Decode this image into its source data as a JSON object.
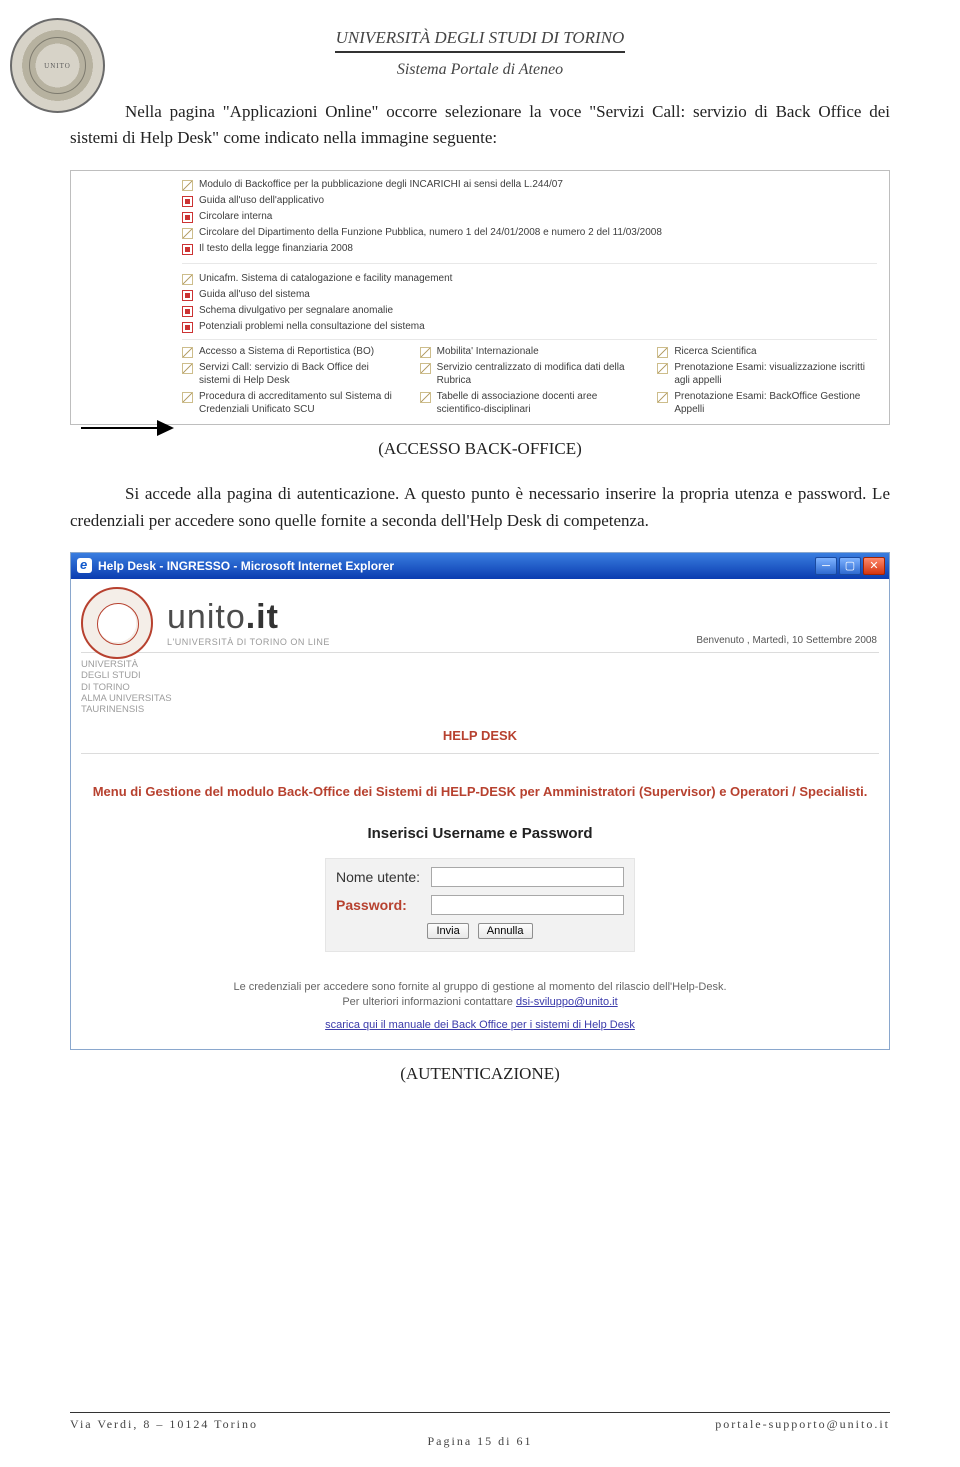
{
  "header": {
    "title": "UNIVERSITÀ DEGLI STUDI DI TORINO",
    "subtitle": "Sistema Portale di Ateneo"
  },
  "body": {
    "p1": "Nella pagina \"Applicazioni Online\" occorre selezionare la voce \"Servizi Call: servizio di Back Office dei sistemi di Help Desk\" come indicato nella immagine seguente:",
    "caption1": "(ACCESSO BACK-OFFICE)",
    "p2": "Si accede alla pagina di autenticazione. A questo punto è necessario inserire la propria utenza e password. Le credenziali per accedere sono quelle fornite a seconda dell'Help Desk di competenza.",
    "caption2": "(AUTENTICAZIONE)"
  },
  "shot1": {
    "rows": [
      {
        "icon": "link",
        "text": "Modulo di Backoffice per la pubblicazione degli INCARICHI ai sensi della L.244/07"
      },
      {
        "icon": "pdf",
        "text": "Guida all'uso dell'applicativo"
      },
      {
        "icon": "pdf",
        "text": "Circolare interna"
      },
      {
        "icon": "link",
        "text": "Circolare del Dipartimento della Funzione Pubblica, numero 1 del 24/01/2008 e numero 2 del 11/03/2008"
      },
      {
        "icon": "pdf",
        "text": "Il testo della legge finanziaria 2008"
      }
    ],
    "rows2": [
      {
        "icon": "link",
        "text": "Unicafm. Sistema di catalogazione e facility management"
      },
      {
        "icon": "pdf",
        "text": "Guida all'uso del sistema"
      },
      {
        "icon": "pdf",
        "text": "Schema divulgativo per segnalare anomalie"
      },
      {
        "icon": "pdf",
        "text": "Potenziali problemi nella consultazione del sistema"
      }
    ],
    "grid": [
      [
        "Accesso a Sistema di Reportistica (BO)",
        "Mobilita' Internazionale",
        "Ricerca Scientifica"
      ],
      [
        "Servizi Call: servizio di Back Office dei sistemi di Help Desk",
        "Servizio centralizzato di modifica dati della Rubrica",
        "Prenotazione Esami: visualizzazione iscritti agli appelli"
      ],
      [
        "Procedura di accreditamento sul Sistema di Credenziali Unificato SCU",
        "Tabelle di associazione docenti aree scientifico-disciplinari",
        "Prenotazione Esami: BackOffice Gestione Appelli"
      ]
    ]
  },
  "shot2": {
    "window_title": "Help Desk - INGRESSO - Microsoft Internet Explorer",
    "brand_logo": "unito.it",
    "brand_tag": "L'UNIVERSITÀ DI TORINO ON LINE",
    "brand_sub": "UNIVERSITÀ\nDEGLI STUDI\nDI TORINO\nALMA UNIVERSITAS\nTAURINENSIS",
    "welcome": "Benvenuto , Martedì, 10 Settembre 2008",
    "hd_title": "HELP DESK",
    "menu_caption": "Menu di Gestione del modulo Back-Office dei Sistemi di HELP-DESK per Amministratori (Supervisor) e Operatori / Specialisti.",
    "insert_title": "Inserisci Username e Password",
    "label_user": "Nome utente:",
    "label_pwd": "Password:",
    "btn_submit": "Invia",
    "btn_cancel": "Annulla",
    "cred_note_1": "Le credenziali per accedere sono fornite al gruppo di gestione al momento del rilascio dell'Help-Desk.",
    "cred_note_2": "Per ulteriori informazioni contattare ",
    "cred_mail": "dsi-sviluppo@unito.it",
    "dl_link": "scarica qui il manuale dei Back Office per i sistemi di Help Desk"
  },
  "footer": {
    "left": "Via Verdi, 8 – 10124 Torino",
    "right": "portale-supporto@unito.it",
    "page": "Pagina 15 di 61"
  }
}
